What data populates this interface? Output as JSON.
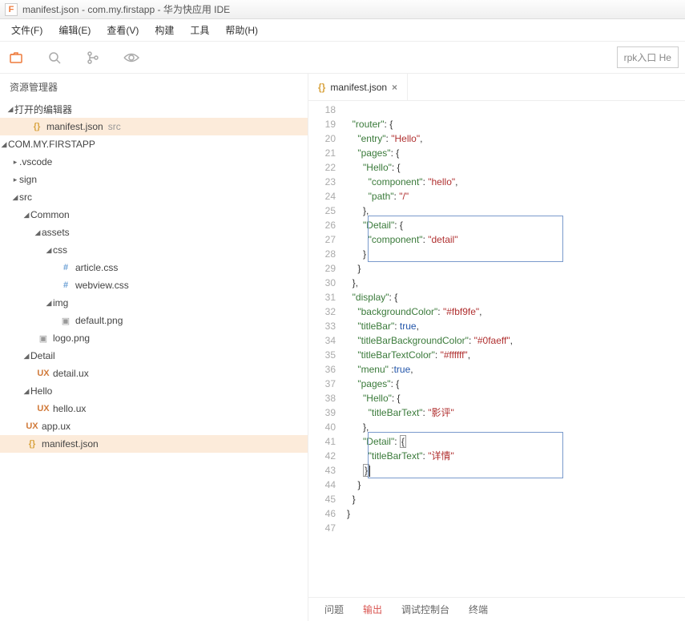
{
  "window": {
    "title": "manifest.json - com.my.firstapp - 华为快应用 IDE"
  },
  "menu": {
    "file": "文件(F)",
    "edit": "编辑(E)",
    "view": "查看(V)",
    "build": "构建",
    "tools": "工具",
    "help": "帮助(H)"
  },
  "toolbar": {
    "rpk": "rpk入口 He"
  },
  "explorer": {
    "title": "资源管理器",
    "open_editors": "打开的编辑器",
    "project": "COM.MY.FIRSTAPP",
    "items": {
      "manifest_open": "manifest.json",
      "manifest_open_dim": "src",
      "vscode": ".vscode",
      "sign": "sign",
      "src": "src",
      "common": "Common",
      "assets": "assets",
      "css": "css",
      "article_css": "article.css",
      "webview_css": "webview.css",
      "img": "img",
      "default_png": "default.png",
      "logo_png": "logo.png",
      "detail": "Detail",
      "detail_ux": "detail.ux",
      "hello": "Hello",
      "hello_ux": "hello.ux",
      "app_ux": "app.ux",
      "manifest_json": "manifest.json"
    }
  },
  "tab": {
    "label": "manifest.json"
  },
  "code": {
    "lines": [
      18,
      19,
      20,
      21,
      22,
      23,
      24,
      25,
      26,
      27,
      28,
      29,
      30,
      31,
      32,
      33,
      34,
      35,
      36,
      37,
      38,
      39,
      40,
      41,
      42,
      43,
      44,
      45,
      46,
      47
    ],
    "l19a": "router",
    "l19b": ": {",
    "l20a": "entry",
    "l20b": "Hello",
    "l21a": "pages",
    "l21b": ": {",
    "l22a": "Hello",
    "l22b": ": {",
    "l23a": "component",
    "l23b": "hello",
    "l24a": "path",
    "l24b": "/",
    "l26a": "Detail",
    "l26b": ": {",
    "l27a": "component",
    "l27b": "detail",
    "l31a": "display",
    "l31b": ": {",
    "l32a": "backgroundColor",
    "l32b": "#fbf9fe",
    "l33a": "titleBar",
    "l33b": "true",
    "l34a": "titleBarBackgroundColor",
    "l34b": "#0faeff",
    "l35a": "titleBarTextColor",
    "l35b": "#ffffff",
    "l36a": "menu",
    "l36b": "true",
    "l37a": "pages",
    "l37b": ": {",
    "l38a": "Hello",
    "l38b": ": {",
    "l39a": "titleBarText",
    "l39b": "影评",
    "l41a": "Detail",
    "l41b": ": {",
    "l42a": "titleBarText",
    "l42b": "详情"
  },
  "panel": {
    "problems": "问题",
    "output": "输出",
    "debug": "调试控制台",
    "terminal": "终端"
  }
}
